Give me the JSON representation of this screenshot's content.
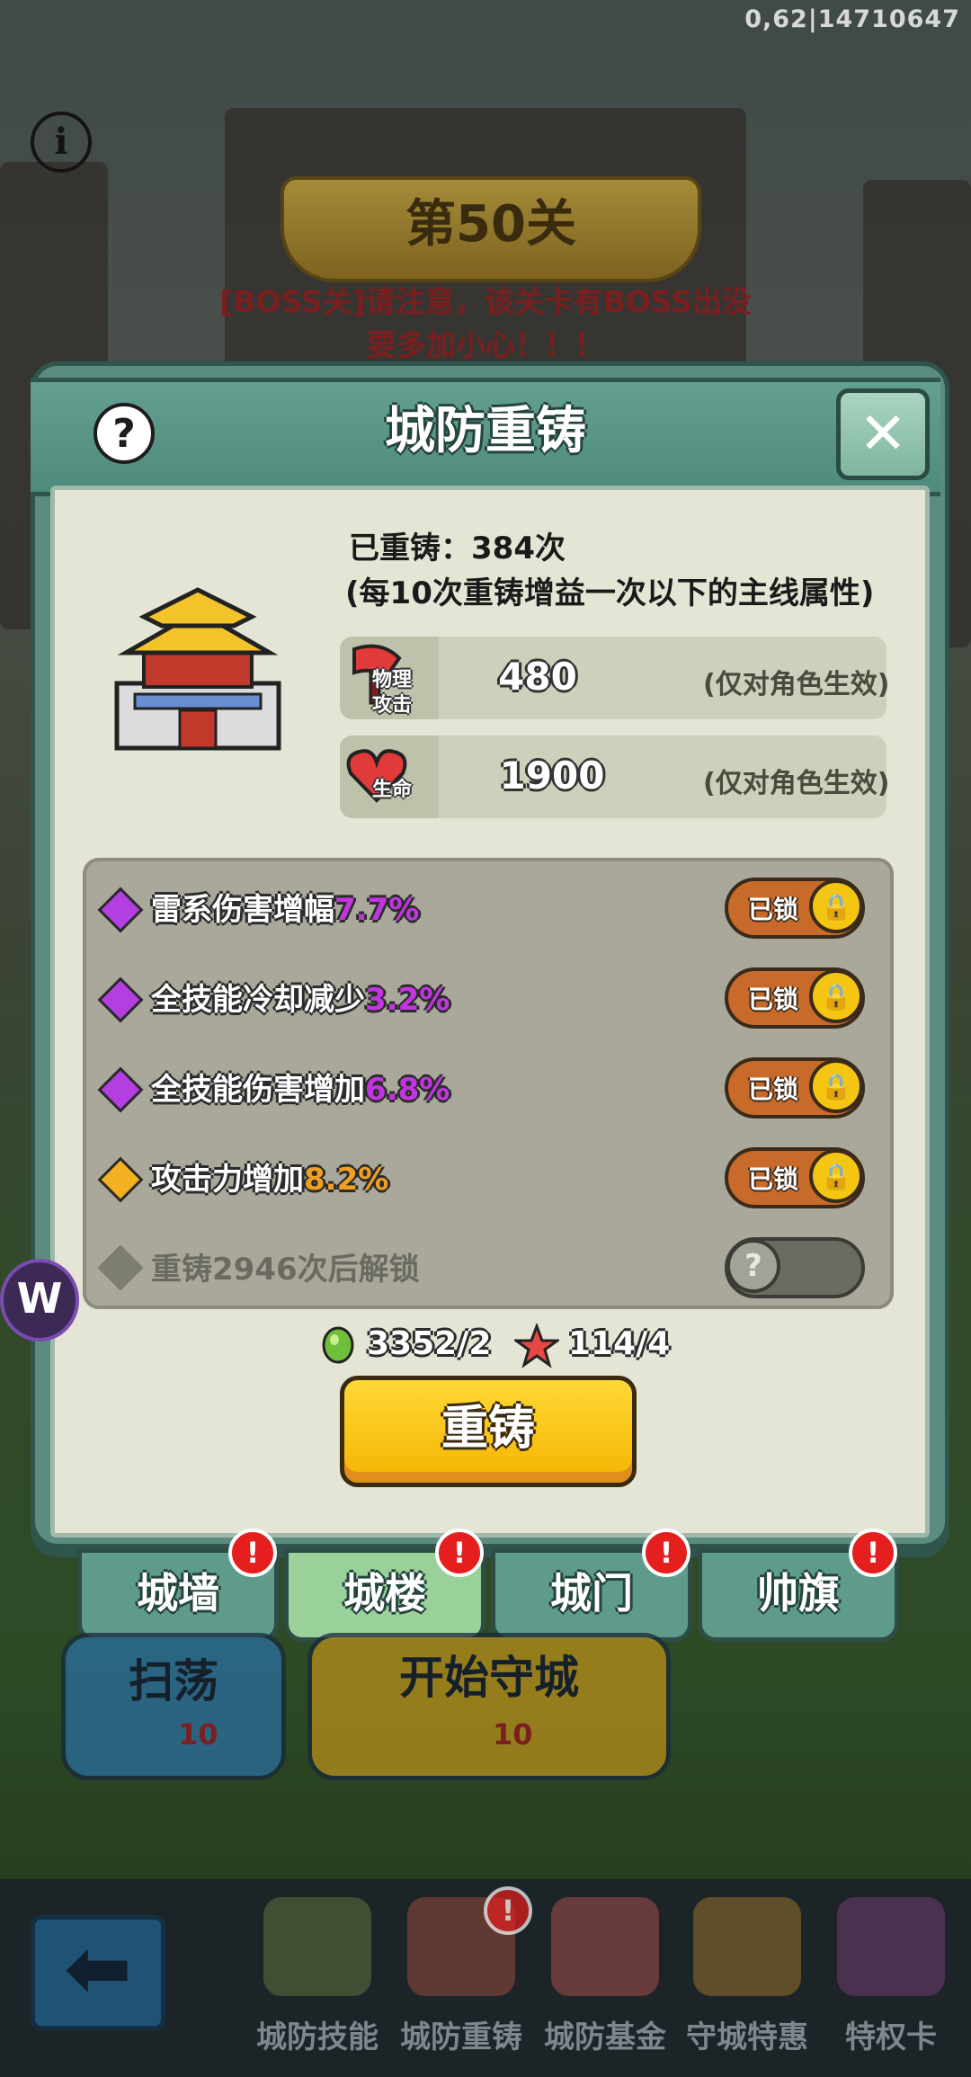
{
  "debug_text": "0,62|14710647",
  "stage": {
    "title": "第50关",
    "boss_warning_line1": "[BOSS关]请注意，该关卡有BOSS出没",
    "boss_warning_line2": "要多加小心！！！"
  },
  "modal": {
    "title": "城防重铸",
    "help_icon": "question-icon",
    "close_icon": "close-icon",
    "recast_count": "已重铸：384次",
    "recast_note": "(每10次重铸增益一次以下的主线属性)",
    "stats": [
      {
        "icon": "axe-icon",
        "icon_label_1": "物理",
        "icon_label_2": "攻击",
        "value": "480",
        "note": "(仅对角色生效)"
      },
      {
        "icon": "heart-icon",
        "icon_label_1": "生命",
        "icon_label_2": "",
        "value": "1900",
        "note": "(仅对角色生效)"
      }
    ],
    "attributes": [
      {
        "name": "雷系伤害增幅",
        "value": "7.7%",
        "gem": "purple",
        "value_color": "#c235e0",
        "lock_label": "已锁",
        "locked": true
      },
      {
        "name": "全技能冷却减少",
        "value": "3.2%",
        "gem": "purple",
        "value_color": "#c235e0",
        "lock_label": "已锁",
        "locked": true
      },
      {
        "name": "全技能伤害增加",
        "value": "6.8%",
        "gem": "purple",
        "value_color": "#c235e0",
        "lock_label": "已锁",
        "locked": true
      },
      {
        "name": "攻击力增加",
        "value": "8.2%",
        "gem": "orange",
        "value_color": "#f0a020",
        "lock_label": "已锁",
        "locked": true
      }
    ],
    "locked_slot": {
      "text": "重铸2946次后解锁",
      "toggle_glyph": "?"
    },
    "costs": [
      {
        "icon": "green-ore-icon",
        "text": "3352/2"
      },
      {
        "icon": "red-star-icon",
        "text": "114/4"
      }
    ],
    "recast_button": "重铸"
  },
  "tabs": [
    {
      "label": "城墙",
      "active": false,
      "badge": "!"
    },
    {
      "label": "城楼",
      "active": true,
      "badge": "!"
    },
    {
      "label": "城门",
      "active": false,
      "badge": "!"
    },
    {
      "label": "帅旗",
      "active": false,
      "badge": "!"
    }
  ],
  "background_buttons": {
    "sweep": {
      "label": "扫荡",
      "count": "10"
    },
    "start": {
      "label": "开始守城",
      "count": "10"
    }
  },
  "bottom_nav": [
    {
      "label": "城防技能"
    },
    {
      "label": "城防重铸",
      "badge": "!"
    },
    {
      "label": "城防基金"
    },
    {
      "label": "守城特惠"
    },
    {
      "label": "特权卡"
    }
  ],
  "colors": {
    "gem_purple": "#b43ee0",
    "gem_orange": "#f3b020",
    "toggle_orange": "#c86a2a",
    "lock_yellow": "#f5c514",
    "recast_yellow": "#ffd836",
    "badge_red": "#e51e1e"
  }
}
